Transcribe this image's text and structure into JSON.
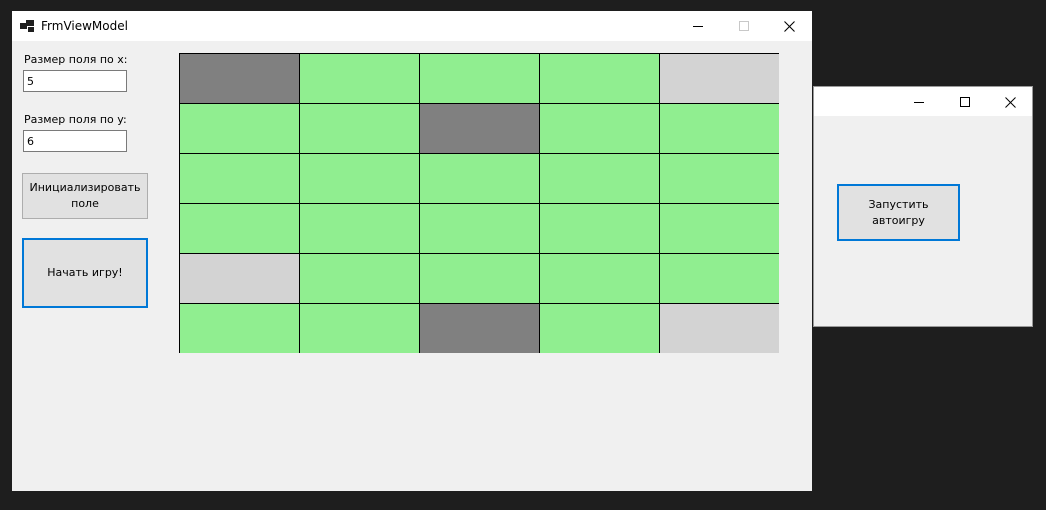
{
  "main_window": {
    "title": "FrmViewModel",
    "icon": "app-form-icon",
    "size_x_label": "Размер поля по x:",
    "size_x_value": "5",
    "size_y_label": "Размер поля по y:",
    "size_y_value": "6",
    "init_button_label": "Инициализировать поле",
    "start_button_label": "Начать игру!",
    "field": {
      "columns": 5,
      "rows": 6,
      "colors": {
        "grass": "#90ee90",
        "rock": "#808080",
        "empty": "#d3d3d3"
      },
      "cells": [
        [
          "rock",
          "grass",
          "grass",
          "grass",
          "empty"
        ],
        [
          "grass",
          "grass",
          "rock",
          "grass",
          "grass"
        ],
        [
          "grass",
          "grass",
          "grass",
          "grass",
          "grass"
        ],
        [
          "grass",
          "grass",
          "grass",
          "grass",
          "grass"
        ],
        [
          "empty",
          "grass",
          "grass",
          "grass",
          "grass"
        ],
        [
          "grass",
          "grass",
          "rock",
          "grass",
          "empty"
        ]
      ]
    }
  },
  "auto_window": {
    "autoplay_button_label": "Запустить автоигру"
  },
  "colors": {
    "desktop": "#1e1e1e",
    "window_bg": "#f0f0f0",
    "titlebar_bg": "#ffffff",
    "focus_accent": "#0078d7",
    "button_bg": "#e1e1e1"
  }
}
